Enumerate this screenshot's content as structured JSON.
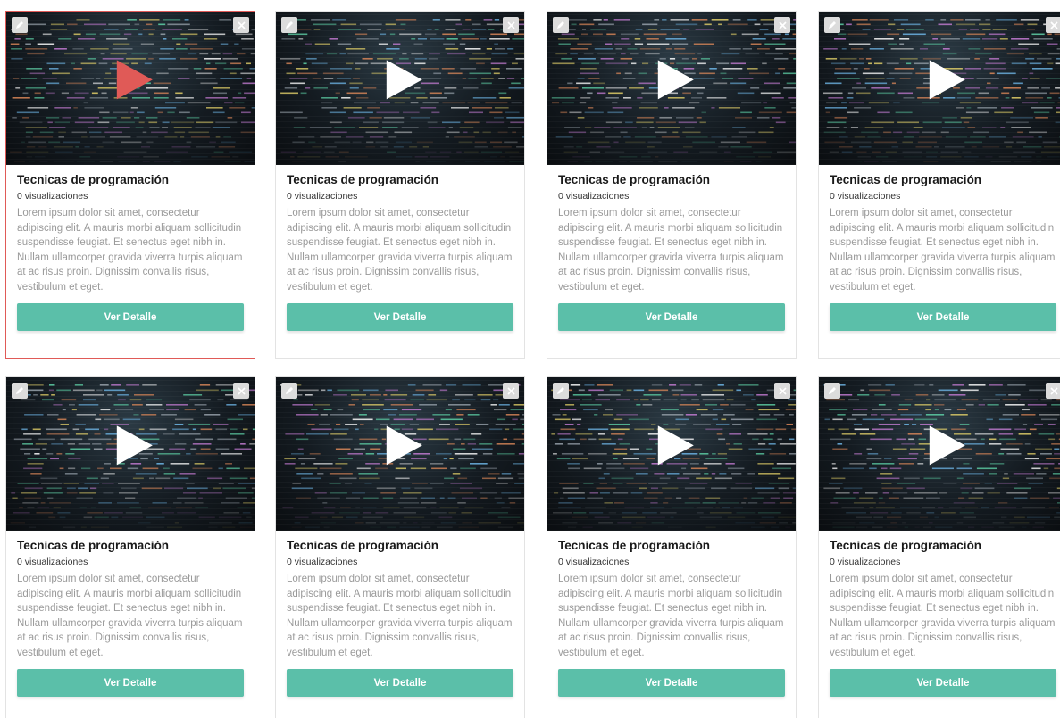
{
  "colors": {
    "accent": "#5bbfa9",
    "active_border": "#e05a57",
    "play_active": "#e05a57"
  },
  "cards": [
    {
      "title": "Tecnicas de programación",
      "views": "0 visualizaciones",
      "description": "Lorem ipsum dolor sit amet, consectetur adipiscing elit. A mauris morbi aliquam sollicitudin suspendisse feugiat. Et senectus eget nibh in. Nullam ullamcorper gravida viverra turpis aliquam at ac risus proin. Dignissim convallis risus, vestibulum et eget.",
      "button": "Ver Detalle",
      "active": true
    },
    {
      "title": "Tecnicas de programación",
      "views": "0 visualizaciones",
      "description": "Lorem ipsum dolor sit amet, consectetur adipiscing elit. A mauris morbi aliquam sollicitudin suspendisse feugiat. Et senectus eget nibh in. Nullam ullamcorper gravida viverra turpis aliquam at ac risus proin. Dignissim convallis risus, vestibulum et eget.",
      "button": "Ver Detalle",
      "active": false
    },
    {
      "title": "Tecnicas de programación",
      "views": "0 visualizaciones",
      "description": "Lorem ipsum dolor sit amet, consectetur adipiscing elit. A mauris morbi aliquam sollicitudin suspendisse feugiat. Et senectus eget nibh in. Nullam ullamcorper gravida viverra turpis aliquam at ac risus proin. Dignissim convallis risus, vestibulum et eget.",
      "button": "Ver Detalle",
      "active": false
    },
    {
      "title": "Tecnicas de programación",
      "views": "0 visualizaciones",
      "description": "Lorem ipsum dolor sit amet, consectetur adipiscing elit. A mauris morbi aliquam sollicitudin suspendisse feugiat. Et senectus eget nibh in. Nullam ullamcorper gravida viverra turpis aliquam at ac risus proin. Dignissim convallis risus, vestibulum et eget.",
      "button": "Ver Detalle",
      "active": false
    },
    {
      "title": "Tecnicas de programación",
      "views": "0 visualizaciones",
      "description": "Lorem ipsum dolor sit amet, consectetur adipiscing elit. A mauris morbi aliquam sollicitudin suspendisse feugiat. Et senectus eget nibh in. Nullam ullamcorper gravida viverra turpis aliquam at ac risus proin. Dignissim convallis risus, vestibulum et eget.",
      "button": "Ver Detalle",
      "active": false
    },
    {
      "title": "Tecnicas de programación",
      "views": "0 visualizaciones",
      "description": "Lorem ipsum dolor sit amet, consectetur adipiscing elit. A mauris morbi aliquam sollicitudin suspendisse feugiat. Et senectus eget nibh in. Nullam ullamcorper gravida viverra turpis aliquam at ac risus proin. Dignissim convallis risus, vestibulum et eget.",
      "button": "Ver Detalle",
      "active": false
    },
    {
      "title": "Tecnicas de programación",
      "views": "0 visualizaciones",
      "description": "Lorem ipsum dolor sit amet, consectetur adipiscing elit. A mauris morbi aliquam sollicitudin suspendisse feugiat. Et senectus eget nibh in. Nullam ullamcorper gravida viverra turpis aliquam at ac risus proin. Dignissim convallis risus, vestibulum et eget.",
      "button": "Ver Detalle",
      "active": false
    },
    {
      "title": "Tecnicas de programación",
      "views": "0 visualizaciones",
      "description": "Lorem ipsum dolor sit amet, consectetur adipiscing elit. A mauris morbi aliquam sollicitudin suspendisse feugiat. Et senectus eget nibh in. Nullam ullamcorper gravida viverra turpis aliquam at ac risus proin. Dignissim convallis risus, vestibulum et eget.",
      "button": "Ver Detalle",
      "active": false
    }
  ],
  "icons": {
    "edit": "pencil-icon",
    "close": "close-icon",
    "play": "play-icon"
  }
}
